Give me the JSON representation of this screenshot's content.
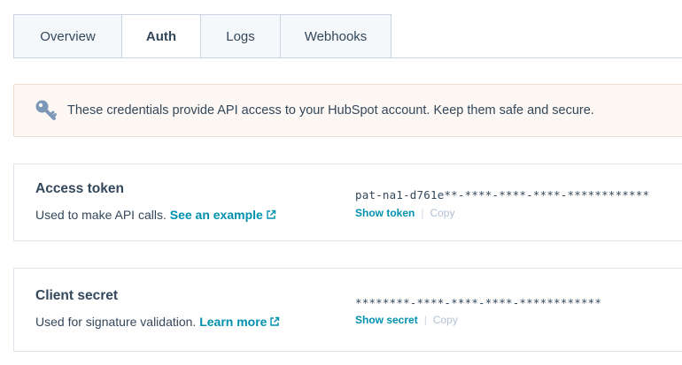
{
  "tabs": [
    {
      "label": "Overview",
      "active": false
    },
    {
      "label": "Auth",
      "active": true
    },
    {
      "label": "Logs",
      "active": false
    },
    {
      "label": "Webhooks",
      "active": false
    }
  ],
  "alert": {
    "icon": "key-icon",
    "text": "These credentials provide API access to your HubSpot account. Keep them safe and secure."
  },
  "access_token": {
    "title": "Access token",
    "description": "Used to make API calls.",
    "link_label": "See an example",
    "value": "pat-na1-d761e**-****-****-****-************",
    "show_label": "Show token",
    "copy_label": "Copy"
  },
  "client_secret": {
    "title": "Client secret",
    "description": "Used for signature validation.",
    "link_label": "Learn more",
    "value": "********-****-****-****-************",
    "show_label": "Show secret",
    "copy_label": "Copy"
  },
  "colors": {
    "link": "#0091ae",
    "text": "#33475b",
    "alert_bg": "#fdf8f4",
    "border": "#cbd6e2"
  }
}
